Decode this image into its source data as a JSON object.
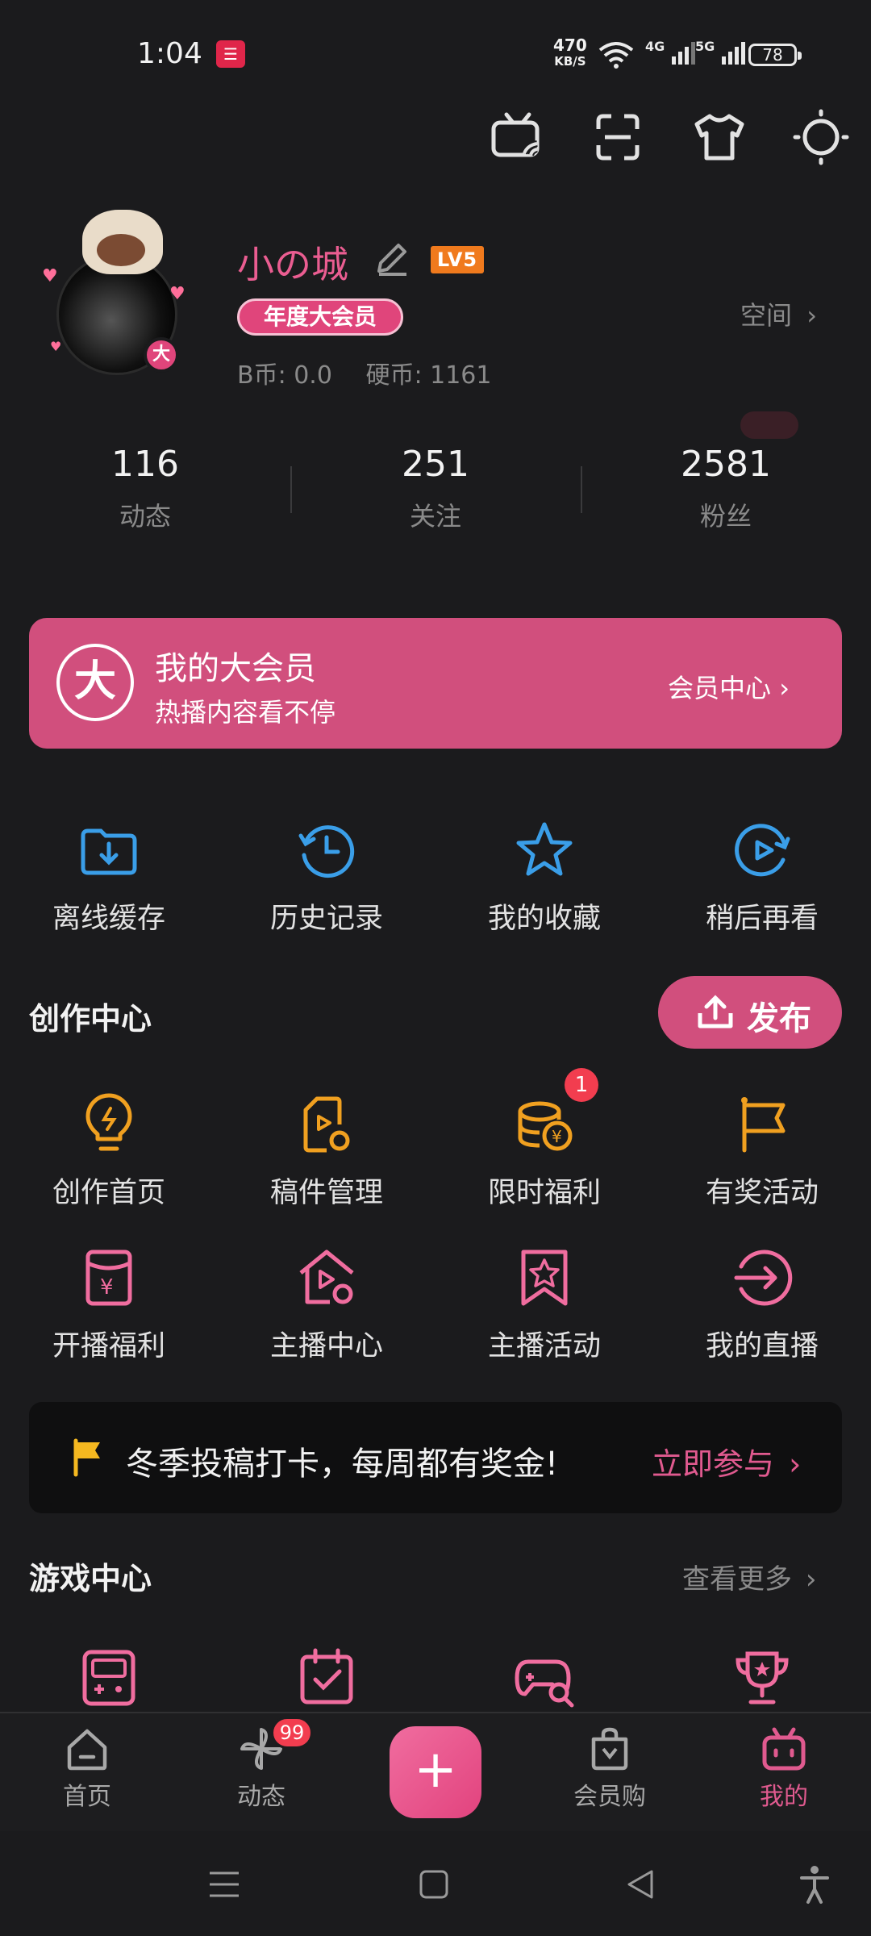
{
  "status_bar": {
    "time": "1:04",
    "app_icon": "bilibili-notify-icon",
    "net_speed_value": "470",
    "net_speed_unit": "KB/S",
    "signal1": "4G",
    "signal2": "5G",
    "battery": "78"
  },
  "toolbar": {
    "icons": [
      "tv-cast-icon",
      "scan-icon",
      "theme-shirt-icon",
      "night-mode-icon"
    ]
  },
  "profile": {
    "username": "小の城",
    "level": "LV5",
    "vip_label": "年度大会员",
    "space_label": "空间",
    "b_coins": "B币: 0.0",
    "coins": "硬币: 1161",
    "avatar_badge": "大"
  },
  "stats": [
    {
      "value": "116",
      "label": "动态"
    },
    {
      "value": "251",
      "label": "关注"
    },
    {
      "value": "2581",
      "label": "粉丝"
    }
  ],
  "vip_banner": {
    "logo": "大",
    "title": "我的大会员",
    "subtitle": "热播内容看不停",
    "center_link": "会员中心"
  },
  "quick_actions": [
    {
      "label": "离线缓存",
      "icon": "offline-download-icon"
    },
    {
      "label": "历史记录",
      "icon": "history-icon"
    },
    {
      "label": "我的收藏",
      "icon": "favorite-star-icon"
    },
    {
      "label": "稍后再看",
      "icon": "watch-later-icon"
    }
  ],
  "creation": {
    "title": "创作中心",
    "publish_label": "发布",
    "badge": "1",
    "items": [
      {
        "label": "创作首页",
        "icon": "lightbulb-icon"
      },
      {
        "label": "稿件管理",
        "icon": "manuscript-icon"
      },
      {
        "label": "限时福利",
        "icon": "coins-icon"
      },
      {
        "label": "有奖活动",
        "icon": "flag-icon"
      },
      {
        "label": "开播福利",
        "icon": "red-envelope-icon"
      },
      {
        "label": "主播中心",
        "icon": "streamer-home-icon"
      },
      {
        "label": "主播活动",
        "icon": "bookmark-star-icon"
      },
      {
        "label": "我的直播",
        "icon": "enter-live-icon"
      }
    ]
  },
  "promo": {
    "text": "冬季投稿打卡，每周都有奖金!",
    "link": "立即参与"
  },
  "game_center": {
    "title": "游戏中心",
    "more_link": "查看更多",
    "icons": [
      "gameboy-icon",
      "calendar-check-icon",
      "gamepad-search-icon",
      "trophy-icon"
    ]
  },
  "bottom_nav": {
    "items": [
      {
        "label": "首页"
      },
      {
        "label": "动态"
      },
      {
        "label": "会员购"
      },
      {
        "label": "我的"
      }
    ],
    "plus": "+",
    "badge": "99"
  },
  "colors": {
    "accent_pink": "#d14f7d",
    "icon_blue": "#3a9ee8",
    "icon_orange": "#f0a020",
    "background": "#1b1b1d"
  }
}
